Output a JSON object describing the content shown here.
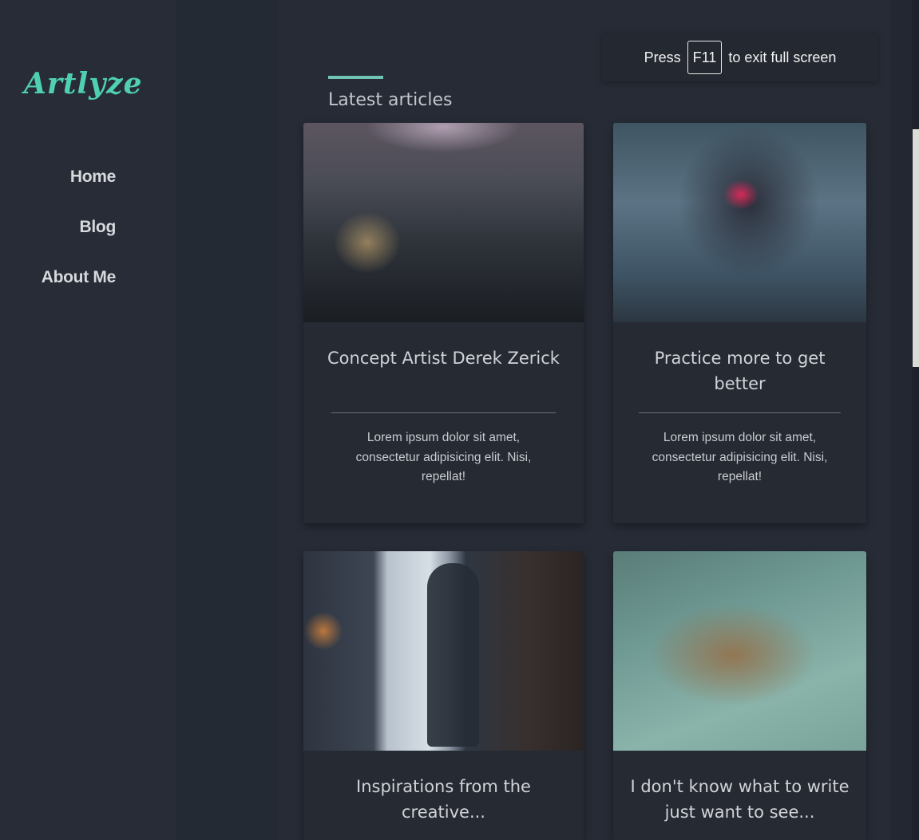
{
  "sidebar": {
    "logo": "Artlyze",
    "nav": [
      {
        "label": "Home"
      },
      {
        "label": "Blog"
      },
      {
        "label": "About Me"
      }
    ]
  },
  "fullscreen_notice": {
    "prefix": "Press",
    "key": "F11",
    "suffix": "to exit full screen"
  },
  "section": {
    "title": "Latest articles"
  },
  "articles": [
    {
      "title": "Concept Artist Derek Zerick",
      "excerpt": "Lorem ipsum dolor sit amet, consectetur adipisicing elit. Nisi, repellat!"
    },
    {
      "title": "Practice more to get better",
      "excerpt": "Lorem ipsum dolor sit amet, consectetur adipisicing elit. Nisi, repellat!"
    },
    {
      "title": "Inspirations from the creative...",
      "excerpt": ""
    },
    {
      "title": "I don't know what to write just want to see...",
      "excerpt": ""
    }
  ],
  "colors": {
    "accent": "#4fd1b0",
    "background": "#222731",
    "card": "#252a33"
  }
}
